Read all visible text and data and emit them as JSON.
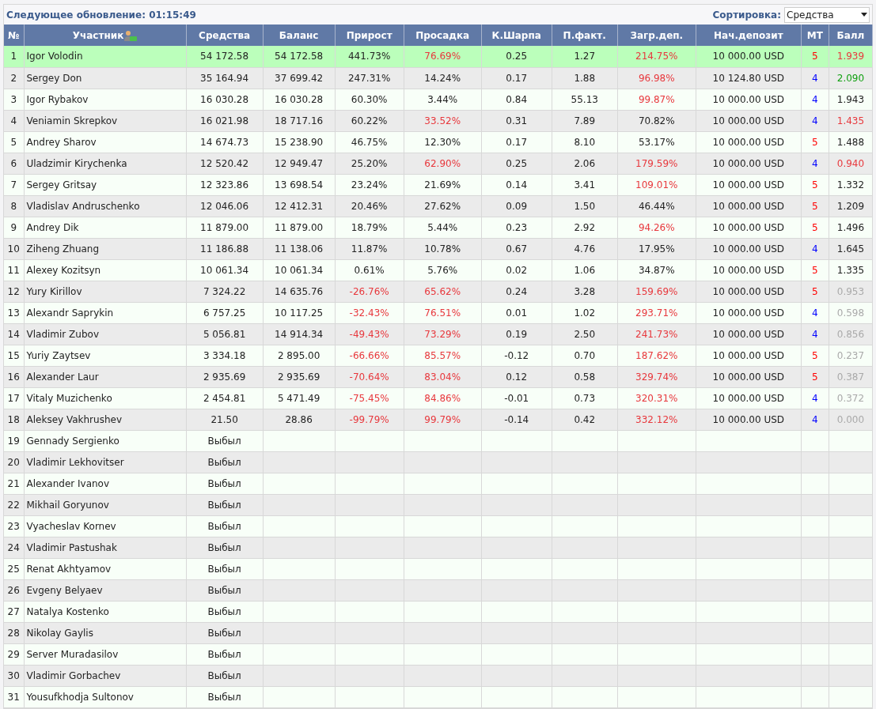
{
  "header": {
    "update_label": "Следующее обновление: 01:15:49",
    "sort_label": "Сортировка:",
    "sort_value": "Средства"
  },
  "columns": [
    "№",
    "Участник",
    "Средства",
    "Баланс",
    "Прирост",
    "Просадка",
    "К.Шарпа",
    "П.факт.",
    "Загр.деп.",
    "Нач.депозит",
    "МТ",
    "Балл"
  ],
  "rows": [
    {
      "n": "1",
      "name": "Igor Volodin",
      "selected": true,
      "equity": "54 172.58",
      "balance": "54 172.58",
      "growth": {
        "text": "441.73%",
        "color": "#222222"
      },
      "drawdown": {
        "text": "76.69%",
        "color": "#e8383d"
      },
      "sharpe": "0.25",
      "pf": "1.27",
      "load": {
        "text": "214.75%",
        "color": "#e8383d"
      },
      "deposit": "10 000.00 USD",
      "mt": {
        "text": "5",
        "color": "#ff0000"
      },
      "score": {
        "text": "1.939",
        "color": "#e8383d"
      }
    },
    {
      "n": "2",
      "name": "Sergey Don",
      "selected": false,
      "equity": "35 164.94",
      "balance": "37 699.42",
      "growth": {
        "text": "247.31%",
        "color": "#222222"
      },
      "drawdown": {
        "text": "14.24%",
        "color": "#222222"
      },
      "sharpe": "0.17",
      "pf": "1.88",
      "load": {
        "text": "96.98%",
        "color": "#e8383d"
      },
      "deposit": "10 124.80 USD",
      "mt": {
        "text": "4",
        "color": "#0000ff"
      },
      "score": {
        "text": "2.090",
        "color": "#12a012"
      }
    },
    {
      "n": "3",
      "name": "Igor Rybakov",
      "selected": false,
      "equity": "16 030.28",
      "balance": "16 030.28",
      "growth": {
        "text": "60.30%",
        "color": "#222222"
      },
      "drawdown": {
        "text": "3.44%",
        "color": "#222222"
      },
      "sharpe": "0.84",
      "pf": "55.13",
      "load": {
        "text": "99.87%",
        "color": "#e8383d"
      },
      "deposit": "10 000.00 USD",
      "mt": {
        "text": "4",
        "color": "#0000ff"
      },
      "score": {
        "text": "1.943",
        "color": "#222222"
      }
    },
    {
      "n": "4",
      "name": "Veniamin Skrepkov",
      "selected": false,
      "equity": "16 021.98",
      "balance": "18 717.16",
      "growth": {
        "text": "60.22%",
        "color": "#222222"
      },
      "drawdown": {
        "text": "33.52%",
        "color": "#e8383d"
      },
      "sharpe": "0.31",
      "pf": "7.89",
      "load": {
        "text": "70.82%",
        "color": "#222222"
      },
      "deposit": "10 000.00 USD",
      "mt": {
        "text": "4",
        "color": "#0000ff"
      },
      "score": {
        "text": "1.435",
        "color": "#e8383d"
      }
    },
    {
      "n": "5",
      "name": "Andrey Sharov",
      "selected": false,
      "equity": "14 674.73",
      "balance": "15 238.90",
      "growth": {
        "text": "46.75%",
        "color": "#222222"
      },
      "drawdown": {
        "text": "12.30%",
        "color": "#222222"
      },
      "sharpe": "0.17",
      "pf": "8.10",
      "load": {
        "text": "53.17%",
        "color": "#222222"
      },
      "deposit": "10 000.00 USD",
      "mt": {
        "text": "5",
        "color": "#ff0000"
      },
      "score": {
        "text": "1.488",
        "color": "#222222"
      }
    },
    {
      "n": "6",
      "name": "Uladzimir Kirychenka",
      "selected": false,
      "equity": "12 520.42",
      "balance": "12 949.47",
      "growth": {
        "text": "25.20%",
        "color": "#222222"
      },
      "drawdown": {
        "text": "62.90%",
        "color": "#e8383d"
      },
      "sharpe": "0.25",
      "pf": "2.06",
      "load": {
        "text": "179.59%",
        "color": "#e8383d"
      },
      "deposit": "10 000.00 USD",
      "mt": {
        "text": "4",
        "color": "#0000ff"
      },
      "score": {
        "text": "0.940",
        "color": "#e8383d"
      }
    },
    {
      "n": "7",
      "name": "Sergey Gritsay",
      "selected": false,
      "equity": "12 323.86",
      "balance": "13 698.54",
      "growth": {
        "text": "23.24%",
        "color": "#222222"
      },
      "drawdown": {
        "text": "21.69%",
        "color": "#222222"
      },
      "sharpe": "0.14",
      "pf": "3.41",
      "load": {
        "text": "109.01%",
        "color": "#e8383d"
      },
      "deposit": "10 000.00 USD",
      "mt": {
        "text": "5",
        "color": "#ff0000"
      },
      "score": {
        "text": "1.332",
        "color": "#222222"
      }
    },
    {
      "n": "8",
      "name": "Vladislav Andruschenko",
      "selected": false,
      "equity": "12 046.06",
      "balance": "12 412.31",
      "growth": {
        "text": "20.46%",
        "color": "#222222"
      },
      "drawdown": {
        "text": "27.62%",
        "color": "#222222"
      },
      "sharpe": "0.09",
      "pf": "1.50",
      "load": {
        "text": "46.44%",
        "color": "#222222"
      },
      "deposit": "10 000.00 USD",
      "mt": {
        "text": "5",
        "color": "#ff0000"
      },
      "score": {
        "text": "1.209",
        "color": "#222222"
      }
    },
    {
      "n": "9",
      "name": "Andrey Dik",
      "selected": false,
      "equity": "11 879.00",
      "balance": "11 879.00",
      "growth": {
        "text": "18.79%",
        "color": "#222222"
      },
      "drawdown": {
        "text": "5.44%",
        "color": "#222222"
      },
      "sharpe": "0.23",
      "pf": "2.92",
      "load": {
        "text": "94.26%",
        "color": "#e8383d"
      },
      "deposit": "10 000.00 USD",
      "mt": {
        "text": "5",
        "color": "#ff0000"
      },
      "score": {
        "text": "1.496",
        "color": "#222222"
      }
    },
    {
      "n": "10",
      "name": "Ziheng Zhuang",
      "selected": false,
      "equity": "11 186.88",
      "balance": "11 138.06",
      "growth": {
        "text": "11.87%",
        "color": "#222222"
      },
      "drawdown": {
        "text": "10.78%",
        "color": "#222222"
      },
      "sharpe": "0.67",
      "pf": "4.76",
      "load": {
        "text": "17.95%",
        "color": "#222222"
      },
      "deposit": "10 000.00 USD",
      "mt": {
        "text": "4",
        "color": "#0000ff"
      },
      "score": {
        "text": "1.645",
        "color": "#222222"
      }
    },
    {
      "n": "11",
      "name": "Alexey Kozitsyn",
      "selected": false,
      "equity": "10 061.34",
      "balance": "10 061.34",
      "growth": {
        "text": "0.61%",
        "color": "#222222"
      },
      "drawdown": {
        "text": "5.76%",
        "color": "#222222"
      },
      "sharpe": "0.02",
      "pf": "1.06",
      "load": {
        "text": "34.87%",
        "color": "#222222"
      },
      "deposit": "10 000.00 USD",
      "mt": {
        "text": "5",
        "color": "#ff0000"
      },
      "score": {
        "text": "1.335",
        "color": "#222222"
      }
    },
    {
      "n": "12",
      "name": "Yury Kirillov",
      "selected": false,
      "equity": "7 324.22",
      "balance": "14 635.76",
      "growth": {
        "text": "-26.76%",
        "color": "#e8383d"
      },
      "drawdown": {
        "text": "65.62%",
        "color": "#e8383d"
      },
      "sharpe": "0.24",
      "pf": "3.28",
      "load": {
        "text": "159.69%",
        "color": "#e8383d"
      },
      "deposit": "10 000.00 USD",
      "mt": {
        "text": "5",
        "color": "#ff0000"
      },
      "score": {
        "text": "0.953",
        "color": "#aaaaaa"
      }
    },
    {
      "n": "13",
      "name": "Alexandr Saprykin",
      "selected": false,
      "equity": "6 757.25",
      "balance": "10 117.25",
      "growth": {
        "text": "-32.43%",
        "color": "#e8383d"
      },
      "drawdown": {
        "text": "76.51%",
        "color": "#e8383d"
      },
      "sharpe": "0.01",
      "pf": "1.02",
      "load": {
        "text": "293.71%",
        "color": "#e8383d"
      },
      "deposit": "10 000.00 USD",
      "mt": {
        "text": "4",
        "color": "#0000ff"
      },
      "score": {
        "text": "0.598",
        "color": "#aaaaaa"
      }
    },
    {
      "n": "14",
      "name": "Vladimir Zubov",
      "selected": false,
      "equity": "5 056.81",
      "balance": "14 914.34",
      "growth": {
        "text": "-49.43%",
        "color": "#e8383d"
      },
      "drawdown": {
        "text": "73.29%",
        "color": "#e8383d"
      },
      "sharpe": "0.19",
      "pf": "2.50",
      "load": {
        "text": "241.73%",
        "color": "#e8383d"
      },
      "deposit": "10 000.00 USD",
      "mt": {
        "text": "4",
        "color": "#0000ff"
      },
      "score": {
        "text": "0.856",
        "color": "#aaaaaa"
      }
    },
    {
      "n": "15",
      "name": "Yuriy Zaytsev",
      "selected": false,
      "equity": "3 334.18",
      "balance": "2 895.00",
      "growth": {
        "text": "-66.66%",
        "color": "#e8383d"
      },
      "drawdown": {
        "text": "85.57%",
        "color": "#e8383d"
      },
      "sharpe": "-0.12",
      "pf": "0.70",
      "load": {
        "text": "187.62%",
        "color": "#e8383d"
      },
      "deposit": "10 000.00 USD",
      "mt": {
        "text": "5",
        "color": "#ff0000"
      },
      "score": {
        "text": "0.237",
        "color": "#aaaaaa"
      }
    },
    {
      "n": "16",
      "name": "Alexander Laur",
      "selected": false,
      "equity": "2 935.69",
      "balance": "2 935.69",
      "growth": {
        "text": "-70.64%",
        "color": "#e8383d"
      },
      "drawdown": {
        "text": "83.04%",
        "color": "#e8383d"
      },
      "sharpe": "0.12",
      "pf": "0.58",
      "load": {
        "text": "329.74%",
        "color": "#e8383d"
      },
      "deposit": "10 000.00 USD",
      "mt": {
        "text": "5",
        "color": "#ff0000"
      },
      "score": {
        "text": "0.387",
        "color": "#aaaaaa"
      }
    },
    {
      "n": "17",
      "name": "Vitaly Muzichenko",
      "selected": false,
      "equity": "2 454.81",
      "balance": "5 471.49",
      "growth": {
        "text": "-75.45%",
        "color": "#e8383d"
      },
      "drawdown": {
        "text": "84.86%",
        "color": "#e8383d"
      },
      "sharpe": "-0.01",
      "pf": "0.73",
      "load": {
        "text": "320.31%",
        "color": "#e8383d"
      },
      "deposit": "10 000.00 USD",
      "mt": {
        "text": "4",
        "color": "#0000ff"
      },
      "score": {
        "text": "0.372",
        "color": "#aaaaaa"
      }
    },
    {
      "n": "18",
      "name": "Aleksey Vakhrushev",
      "selected": false,
      "equity": "21.50",
      "balance": "28.86",
      "growth": {
        "text": "-99.79%",
        "color": "#e8383d"
      },
      "drawdown": {
        "text": "99.79%",
        "color": "#e8383d"
      },
      "sharpe": "-0.14",
      "pf": "0.42",
      "load": {
        "text": "332.12%",
        "color": "#e8383d"
      },
      "deposit": "10 000.00 USD",
      "mt": {
        "text": "4",
        "color": "#0000ff"
      },
      "score": {
        "text": "0.000",
        "color": "#aaaaaa"
      }
    },
    {
      "n": "19",
      "name": "Gennady Sergienko",
      "selected": false,
      "equity": "Выбыл"
    },
    {
      "n": "20",
      "name": "Vladimir Lekhovitser",
      "selected": false,
      "equity": "Выбыл"
    },
    {
      "n": "21",
      "name": "Alexander Ivanov",
      "selected": false,
      "equity": "Выбыл"
    },
    {
      "n": "22",
      "name": "Mikhail Goryunov",
      "selected": false,
      "equity": "Выбыл"
    },
    {
      "n": "23",
      "name": "Vyacheslav Kornev",
      "selected": false,
      "equity": "Выбыл"
    },
    {
      "n": "24",
      "name": "Vladimir Pastushak",
      "selected": false,
      "equity": "Выбыл"
    },
    {
      "n": "25",
      "name": "Renat Akhtyamov",
      "selected": false,
      "equity": "Выбыл"
    },
    {
      "n": "26",
      "name": "Evgeny Belyaev",
      "selected": false,
      "equity": "Выбыл"
    },
    {
      "n": "27",
      "name": "Natalya Kostenko",
      "selected": false,
      "equity": "Выбыл"
    },
    {
      "n": "28",
      "name": "Nikolay Gaylis",
      "selected": false,
      "equity": "Выбыл"
    },
    {
      "n": "29",
      "name": "Server Muradasilov",
      "selected": false,
      "equity": "Выбыл"
    },
    {
      "n": "30",
      "name": "Vladimir Gorbachev",
      "selected": false,
      "equity": "Выбыл"
    },
    {
      "n": "31",
      "name": "Yousufkhodja Sultonov",
      "selected": false,
      "equity": "Выбыл"
    }
  ]
}
